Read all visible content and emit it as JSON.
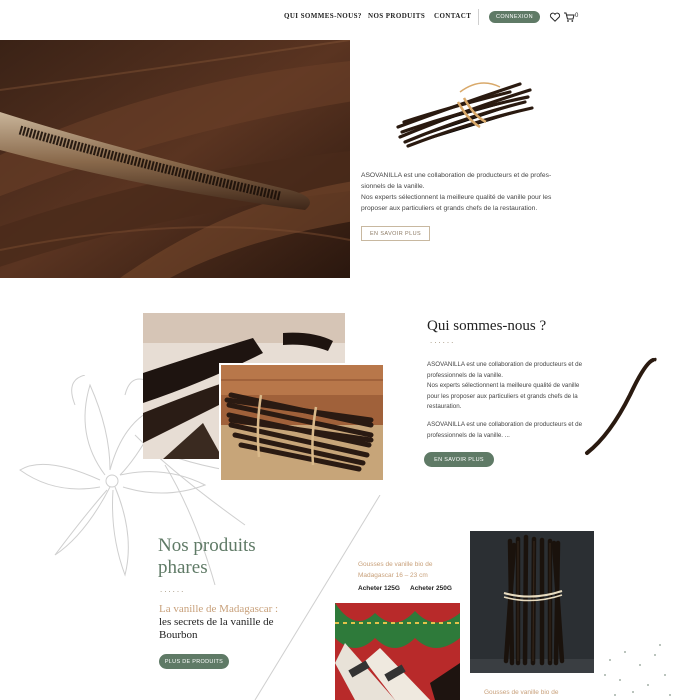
{
  "nav": {
    "links": [
      "QUI SOMMES-NOUS?",
      "NOS PRODUITS",
      "CONTACT"
    ],
    "connexion_label": "CONNEXION",
    "cart_count": "0",
    "icons": [
      "heart-icon",
      "cart-icon"
    ]
  },
  "hero": {
    "text_line1": "ASOVANILLA est une collaboration de producteurs et de profes-sionnels de la vanille.",
    "text_line2": "Nos experts sélectionnent la meilleure qualité de vanille pour les proposer aux particuliers et grands chefs de la restauration.",
    "button_label": "EN SAVOIR PLUS"
  },
  "about": {
    "title": "Qui sommes-nous ?",
    "dots": "......",
    "p1": "ASOVANILLA est une collaboration de producteurs et de professionnels de la vanille.",
    "p2": "Nos experts sélectionnent la meilleure qualité de vanille pour les proposer aux particuliers et grands chefs de la restauration.",
    "p3": "ASOVANILLA est une collaboration de producteurs et de professionnels de la vanille. ...",
    "button_label": "EN SAVOIR PLUS"
  },
  "products": {
    "title": "Nos produits phares",
    "dots": "......",
    "subtitle_accent": "La vanille de Madagascar :",
    "subtitle": "les secrets de la vanille de Bourbon",
    "button_label": "PLUS DE PRODUITS",
    "card1": {
      "name": "Gousses de vanille bio de Madagascar 16 – 23 cm",
      "buy1": "Acheter 125G",
      "buy2": "Acheter 250G"
    },
    "card2": {
      "name": "Gousses de vanille bio de"
    }
  },
  "colors": {
    "accent_green": "#5f7a66",
    "accent_tan": "#c8a07a"
  }
}
